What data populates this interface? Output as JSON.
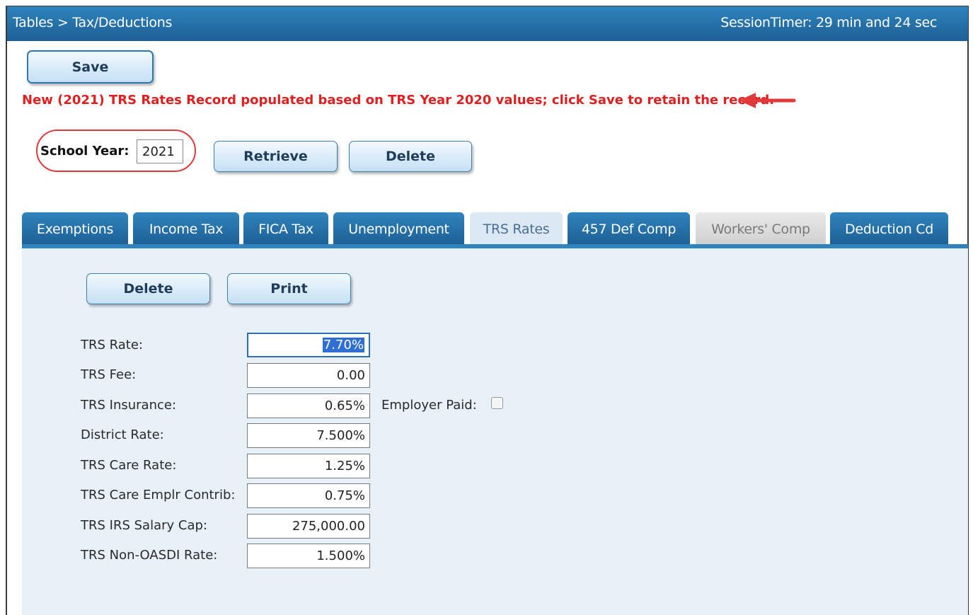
{
  "header": {
    "breadcrumb": "Tables > Tax/Deductions",
    "session_timer": "SessionTimer: 29 min and 24 sec"
  },
  "toolbar": {
    "save_label": "Save"
  },
  "message": "New (2021) TRS Rates Record populated based on TRS Year 2020 values; click Save to retain the record.",
  "school_year": {
    "label": "School Year:",
    "value": "2021",
    "retrieve_label": "Retrieve",
    "delete_label": "Delete"
  },
  "tabs": [
    {
      "label": "Exemptions"
    },
    {
      "label": "Income Tax"
    },
    {
      "label": "FICA Tax"
    },
    {
      "label": "Unemployment"
    },
    {
      "label": "TRS Rates"
    },
    {
      "label": "457 Def Comp"
    },
    {
      "label": "Workers' Comp"
    },
    {
      "label": "Deduction Cd"
    }
  ],
  "active_tab": "TRS Rates",
  "panel": {
    "delete_label": "Delete",
    "print_label": "Print",
    "fields": [
      {
        "label": "TRS Rate:",
        "value": "7.70%"
      },
      {
        "label": "TRS Fee:",
        "value": "0.00"
      },
      {
        "label": "TRS Insurance:",
        "value": "0.65%"
      },
      {
        "label": "District Rate:",
        "value": "7.500%"
      },
      {
        "label": "TRS Care Rate:",
        "value": "1.25%"
      },
      {
        "label": "TRS Care Emplr Contrib:",
        "value": "0.75%"
      },
      {
        "label": "TRS IRS Salary Cap:",
        "value": "275,000.00"
      },
      {
        "label": "TRS Non-OASDI Rate:",
        "value": "1.500%"
      }
    ],
    "employer_paid_label": "Employer Paid:",
    "employer_paid_checked": false
  },
  "colors": {
    "header_blue": "#1d5f95",
    "message_red": "#e02020",
    "annotation_red": "#e03a3a",
    "panel_bg": "#e8f0f8"
  }
}
